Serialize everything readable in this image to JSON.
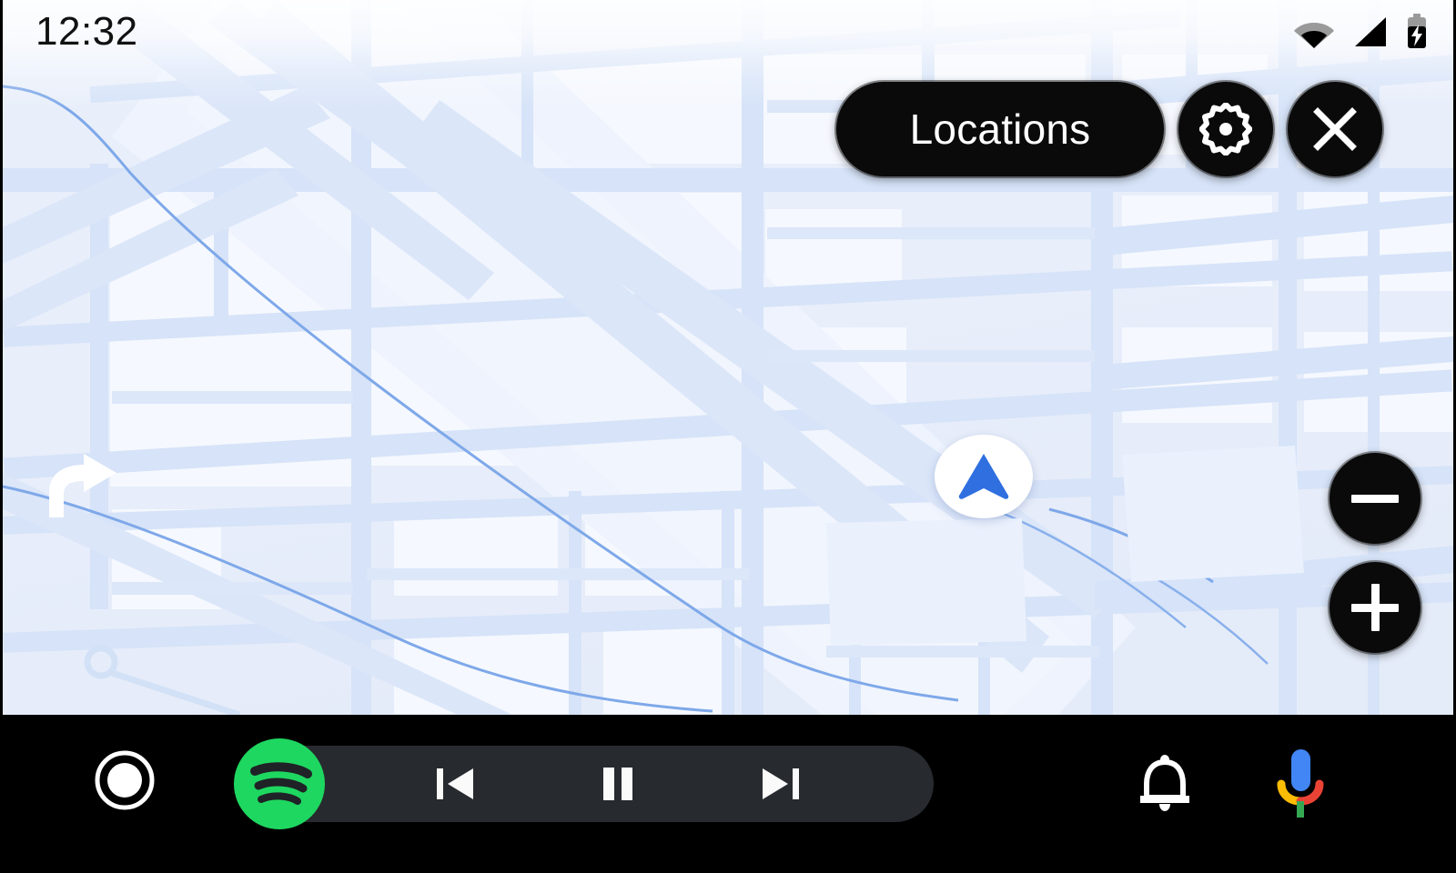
{
  "status_bar": {
    "clock": "12:32",
    "icons": [
      {
        "name": "wifi-icon",
        "label": "Wi-Fi"
      },
      {
        "name": "cellular-signal-icon",
        "label": "Cellular signal"
      },
      {
        "name": "battery-charging-icon",
        "label": "Battery charging"
      }
    ]
  },
  "map": {
    "name": "navigation-map",
    "base_color": "#eef3fc",
    "road_color": "#d5e2f7",
    "block_color": "#f4f8fe",
    "water_line_color": "#7da6e8",
    "nav_puck": {
      "name": "current-location-puck",
      "arrow_color": "#2f6fe0",
      "background": "#ffffff"
    },
    "turn_arrow": {
      "name": "turn-right-arrow",
      "color": "#ffffff"
    }
  },
  "top_controls": {
    "locations_label": "Locations",
    "settings_label": "Settings",
    "close_label": "Close",
    "accent": "#0a0a0a"
  },
  "zoom_controls": {
    "zoom_out_label": "Zoom out",
    "zoom_in_label": "Zoom in"
  },
  "nav_bar": {
    "background": "#000000",
    "home_label": "Home",
    "app": {
      "name": "Spotify",
      "brand_color": "#1ed760"
    },
    "media": {
      "pill_color": "#272a2e",
      "previous_label": "Previous track",
      "play_pause_label": "Pause",
      "play_pause_state": "playing",
      "next_label": "Next track"
    },
    "notifications_label": "Notifications",
    "assistant_label": "Google Assistant",
    "assistant_colors": {
      "blue": "#4285f4",
      "red": "#ea4335",
      "yellow": "#fbbc04",
      "green": "#34a853"
    }
  }
}
